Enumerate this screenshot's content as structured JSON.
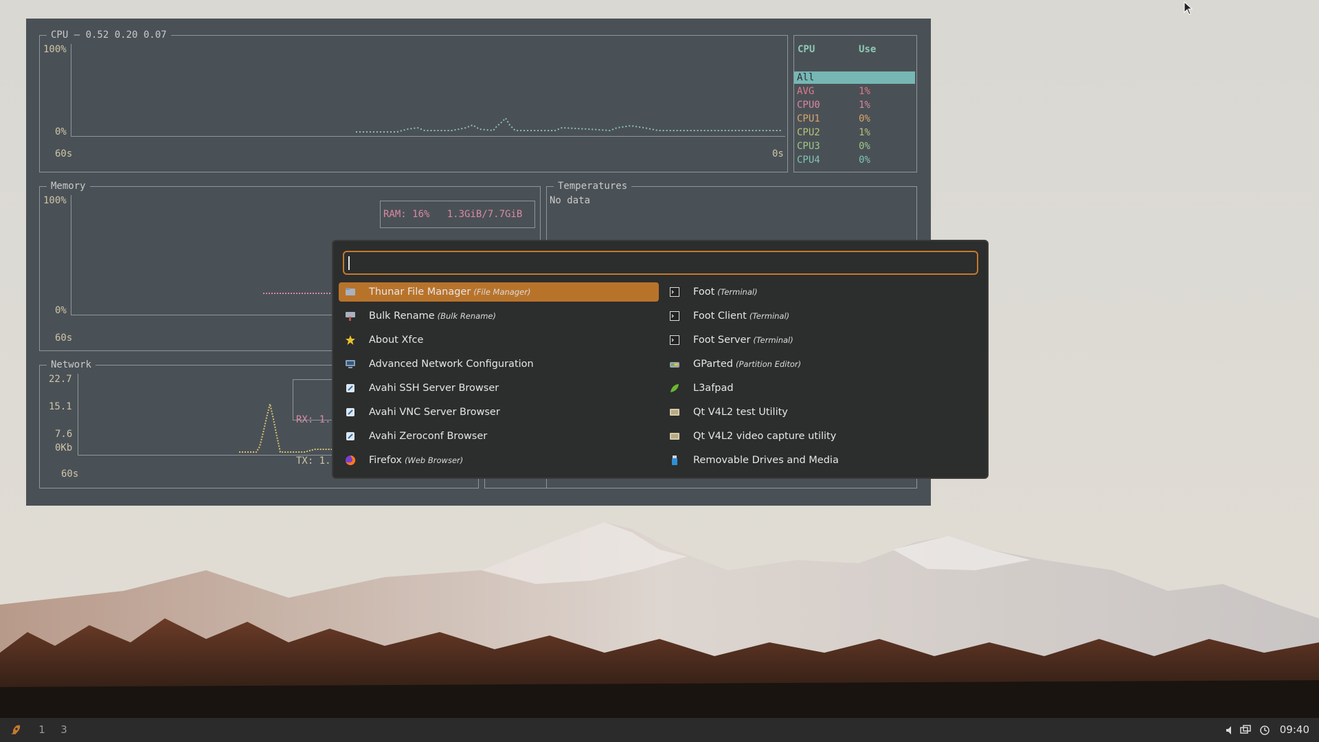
{
  "cpu": {
    "title": "CPU — 0.52 0.20 0.07",
    "y_top": "100%",
    "y_bottom": "0%",
    "x_left": "60s",
    "x_right": "0s",
    "table_headers": [
      "CPU",
      "Use"
    ],
    "rows": [
      {
        "name": "All",
        "value": ""
      },
      {
        "name": "AVG",
        "value": "1%"
      },
      {
        "name": "CPU0",
        "value": "1%"
      },
      {
        "name": "CPU1",
        "value": "0%"
      },
      {
        "name": "CPU2",
        "value": "1%"
      },
      {
        "name": "CPU3",
        "value": "0%"
      },
      {
        "name": "CPU4",
        "value": "0%"
      }
    ]
  },
  "memory": {
    "title": "Memory",
    "y_top": "100%",
    "y_bottom": "0%",
    "x_left": "60s",
    "ram_label": "RAM: 16%   1.3GiB/7.7GiB"
  },
  "temperatures": {
    "title": "Temperatures",
    "status": "No data"
  },
  "network": {
    "title": "Network",
    "ticks": [
      "22.7",
      "15.1",
      "7.6",
      "0Kb"
    ],
    "x_left": "60s",
    "rx": "RX: 1.",
    "tx": "TX: 1."
  },
  "launcher": {
    "search_value": "",
    "apps": [
      {
        "name": "Thunar File Manager",
        "sub": "(File Manager)",
        "icon": "folder-icon"
      },
      {
        "name": "Bulk Rename",
        "sub": "(Bulk Rename)",
        "icon": "bulk-rename-icon"
      },
      {
        "name": "About Xfce",
        "sub": "",
        "icon": "star-icon"
      },
      {
        "name": "Advanced Network Configuration",
        "sub": "",
        "icon": "network-icon"
      },
      {
        "name": "Avahi SSH Server Browser",
        "sub": "",
        "icon": "avahi-icon"
      },
      {
        "name": "Avahi VNC Server Browser",
        "sub": "",
        "icon": "avahi-icon"
      },
      {
        "name": "Avahi Zeroconf Browser",
        "sub": "",
        "icon": "avahi-icon"
      },
      {
        "name": "Firefox",
        "sub": "(Web Browser)",
        "icon": "firefox-icon"
      },
      {
        "name": "Foot",
        "sub": "(Terminal)",
        "icon": "terminal-icon"
      },
      {
        "name": "Foot Client",
        "sub": "(Terminal)",
        "icon": "terminal-icon"
      },
      {
        "name": "Foot Server",
        "sub": "(Terminal)",
        "icon": "terminal-icon"
      },
      {
        "name": "GParted",
        "sub": "(Partition Editor)",
        "icon": "gparted-icon"
      },
      {
        "name": "L3afpad",
        "sub": "",
        "icon": "leaf-icon"
      },
      {
        "name": "Qt V4L2 test Utility",
        "sub": "",
        "icon": "video-icon"
      },
      {
        "name": "Qt V4L2 video capture utility",
        "sub": "",
        "icon": "video-icon"
      },
      {
        "name": "Removable Drives and Media",
        "sub": "",
        "icon": "usb-drive-icon"
      }
    ]
  },
  "taskbar": {
    "workspaces": [
      "1",
      "3"
    ],
    "clock": "09:40"
  }
}
